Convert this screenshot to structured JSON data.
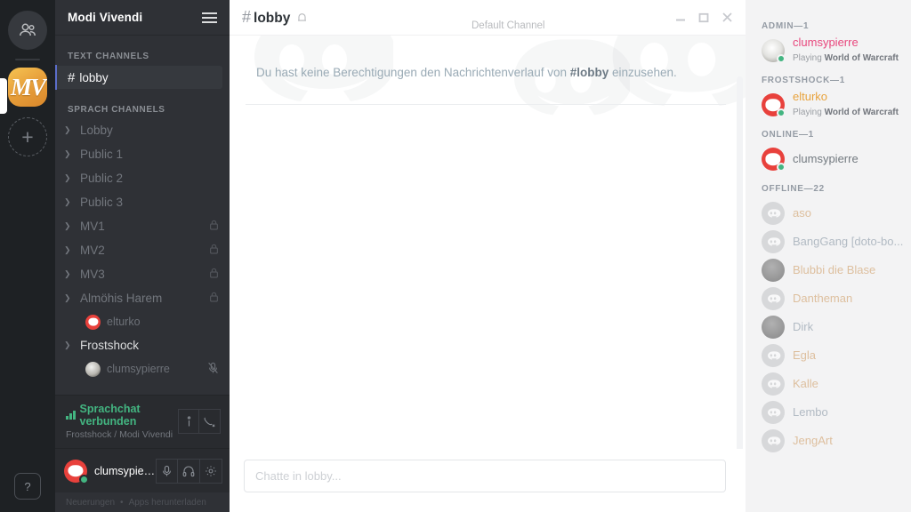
{
  "window": {
    "minimize_label": "—",
    "maximize_label": "□",
    "close_label": "×"
  },
  "rail": {
    "friends_icon": "friends-icon",
    "server_initials": "MV",
    "add_server_label": "+",
    "help_label": "?"
  },
  "guild": {
    "name": "Modi Vivendi",
    "menu_icon": "hamburger-icon"
  },
  "sidebar": {
    "text_category": "TEXT CHANNELS",
    "text_channels": [
      {
        "name": "lobby",
        "hash": "#",
        "active": true
      }
    ],
    "voice_category": "SPRACH CHANNELS",
    "voice_channels": [
      {
        "name": "Lobby",
        "locked": false,
        "lit": false,
        "users": []
      },
      {
        "name": "Public 1",
        "locked": false,
        "lit": false,
        "users": []
      },
      {
        "name": "Public 2",
        "locked": false,
        "lit": false,
        "users": []
      },
      {
        "name": "Public 3",
        "locked": false,
        "lit": false,
        "users": []
      },
      {
        "name": "MV1",
        "locked": true,
        "lit": false,
        "users": []
      },
      {
        "name": "MV2",
        "locked": true,
        "lit": false,
        "users": []
      },
      {
        "name": "MV3",
        "locked": true,
        "lit": false,
        "users": []
      },
      {
        "name": "Almöhis Harem",
        "locked": true,
        "lit": false,
        "users": [
          {
            "name": "elturko",
            "avatar": "discord-logo",
            "muted": false
          }
        ]
      },
      {
        "name": "Frostshock",
        "locked": false,
        "lit": true,
        "users": [
          {
            "name": "clumsypierre",
            "avatar": "photo",
            "muted": true
          }
        ]
      }
    ]
  },
  "voice_panel": {
    "status": "Sprachchat verbunden",
    "location": "Frostshock / Modi Vivendi",
    "signal_icon": "signal-bars-icon",
    "info_icon": "ping-icon",
    "disconnect_icon": "disconnect-call-icon"
  },
  "user_panel": {
    "username": "clumsypier...",
    "mic_icon": "microphone-icon",
    "deafen_icon": "headphones-icon",
    "settings_icon": "gear-icon"
  },
  "footer": {
    "changelog": "Neuerungen",
    "separator": "•",
    "download": "Apps herunterladen"
  },
  "channel_header": {
    "hash": "#",
    "name": "lobby",
    "bell_icon": "bell-icon",
    "subtitle": "Default Channel"
  },
  "chat": {
    "permission_prefix": "Du hast keine Berechtigungen den Nachrichtenverlauf von ",
    "permission_channel": "#lobby",
    "permission_suffix": " einzusehen.",
    "input_placeholder": "Chatte in lobby..."
  },
  "members": {
    "groups": [
      {
        "label": "ADMIN—1",
        "members": [
          {
            "name": "clumsypierre",
            "color": "#e8477d",
            "game_prefix": "Playing ",
            "game": "World of Warcraft",
            "avatar": "snow",
            "status": "online",
            "offline": false
          }
        ]
      },
      {
        "label": "FROSTSHOCK—1",
        "members": [
          {
            "name": "elturko",
            "color": "#e8a33d",
            "game_prefix": "Playing ",
            "game": "World of Warcraft",
            "avatar": "discord-red",
            "status": "online",
            "offline": false
          }
        ]
      },
      {
        "label": "ONLINE—1",
        "members": [
          {
            "name": "clumsypierre",
            "color": "#737a80",
            "game_prefix": "",
            "game": "",
            "avatar": "discord-red",
            "status": "online",
            "offline": false
          }
        ]
      },
      {
        "label": "OFFLINE—22",
        "members": [
          {
            "name": "aso",
            "color": "#d1a06a",
            "game_prefix": "",
            "game": "",
            "avatar": "discord-grey",
            "status": "offline",
            "offline": true
          },
          {
            "name": "BangGang [doto-bo...",
            "color": "#8a98a6",
            "game_prefix": "",
            "game": "",
            "avatar": "discord-grey",
            "status": "offline",
            "offline": true
          },
          {
            "name": "Blubbi die Blase",
            "color": "#d1a06a",
            "game_prefix": "",
            "game": "",
            "avatar": "dark",
            "status": "offline",
            "offline": true
          },
          {
            "name": "Dantheman",
            "color": "#d1a06a",
            "game_prefix": "",
            "game": "",
            "avatar": "discord-grey",
            "status": "offline",
            "offline": true
          },
          {
            "name": "Dirk",
            "color": "#8a98a6",
            "game_prefix": "",
            "game": "",
            "avatar": "dark",
            "status": "offline",
            "offline": true
          },
          {
            "name": "Egla",
            "color": "#d1a06a",
            "game_prefix": "",
            "game": "",
            "avatar": "discord-grey",
            "status": "offline",
            "offline": true
          },
          {
            "name": "Kalle",
            "color": "#d1a06a",
            "game_prefix": "",
            "game": "",
            "avatar": "discord-grey",
            "status": "offline",
            "offline": true
          },
          {
            "name": "Lembo",
            "color": "#8a98a6",
            "game_prefix": "",
            "game": "",
            "avatar": "discord-grey",
            "status": "offline",
            "offline": true
          },
          {
            "name": "JengArt",
            "color": "#d1a06a",
            "game_prefix": "",
            "game": "",
            "avatar": "discord-grey",
            "status": "offline",
            "offline": true
          }
        ]
      }
    ]
  }
}
